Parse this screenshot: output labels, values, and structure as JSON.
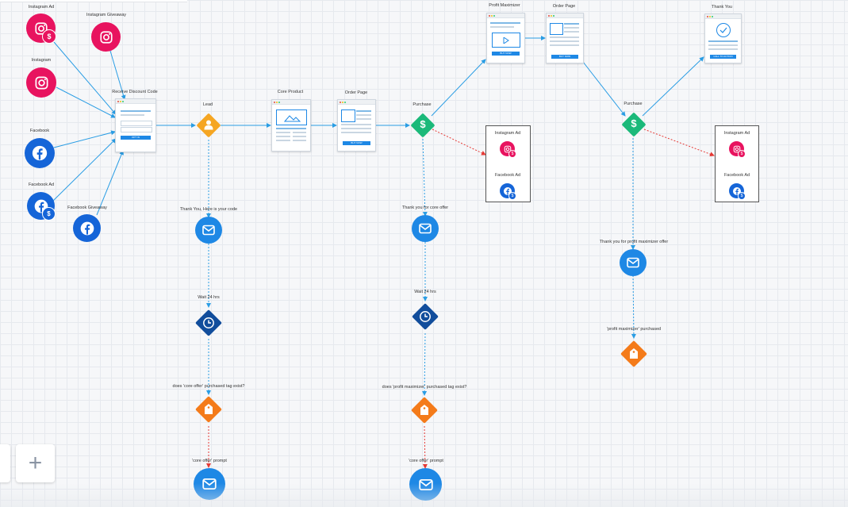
{
  "colors": {
    "instagram": "#e8135f",
    "facebook": "#1565d8",
    "lead": "#f5a623",
    "purchase": "#1bb97a",
    "email": "#1e88e5",
    "wait": "#114d9c",
    "tag": "#f47b1a",
    "solid_edge": "#2a9de4",
    "dashed_edge": "#2a9de4",
    "dashed_no": "#e53935"
  },
  "sources": {
    "instagram_ad": "Instagram Ad",
    "instagram_giveaway": "Instagram Giveaway",
    "instagram": "Instagram",
    "facebook": "Facebook",
    "facebook_ad": "Facebook Ad",
    "facebook_giveaway": "Facebook Giveaway"
  },
  "pages": {
    "receive_discount": {
      "label": "Receive Discount Code",
      "button": "OPT IN"
    },
    "core_product": {
      "label": "Core Product"
    },
    "order_page_1": {
      "label": "Order Page",
      "button": "BUY NOW"
    },
    "profit_maximizer": {
      "label": "Profit Maximizer",
      "button": "BUY NOW"
    },
    "order_page_2": {
      "label": "Order Page",
      "button": "BUY NOW"
    },
    "thank_you": {
      "label": "Thank You",
      "button": "CALL TO ACTION"
    }
  },
  "events": {
    "lead": "Lead",
    "purchase_1": "Purchase",
    "purchase_2": "Purchase"
  },
  "retarget_box_1": {
    "item1": "Instagram Ad",
    "item2": "Facebook Ad"
  },
  "retarget_box_2": {
    "item1": "Instagram Ad",
    "item2": "Facebook Ad"
  },
  "steps": {
    "email_code": "Thank You, Here is your code",
    "wait_1": "Wait 24 hrs",
    "tag_check_1": "does 'core offer' purchased tag exist?",
    "email_prompt_1": "'core offer' prompt",
    "email_core": "Thank you for core offer",
    "wait_2": "Wait 24 hrs",
    "tag_check_2": "does 'profit maximizer' purchased tag exist?",
    "email_prompt_2": "'core offer' prompt",
    "email_pm": "Thank you for profit maximizer offer",
    "tag_pm": "'profit maximizer' purchased"
  },
  "toolbar": {
    "add_label": "+"
  }
}
